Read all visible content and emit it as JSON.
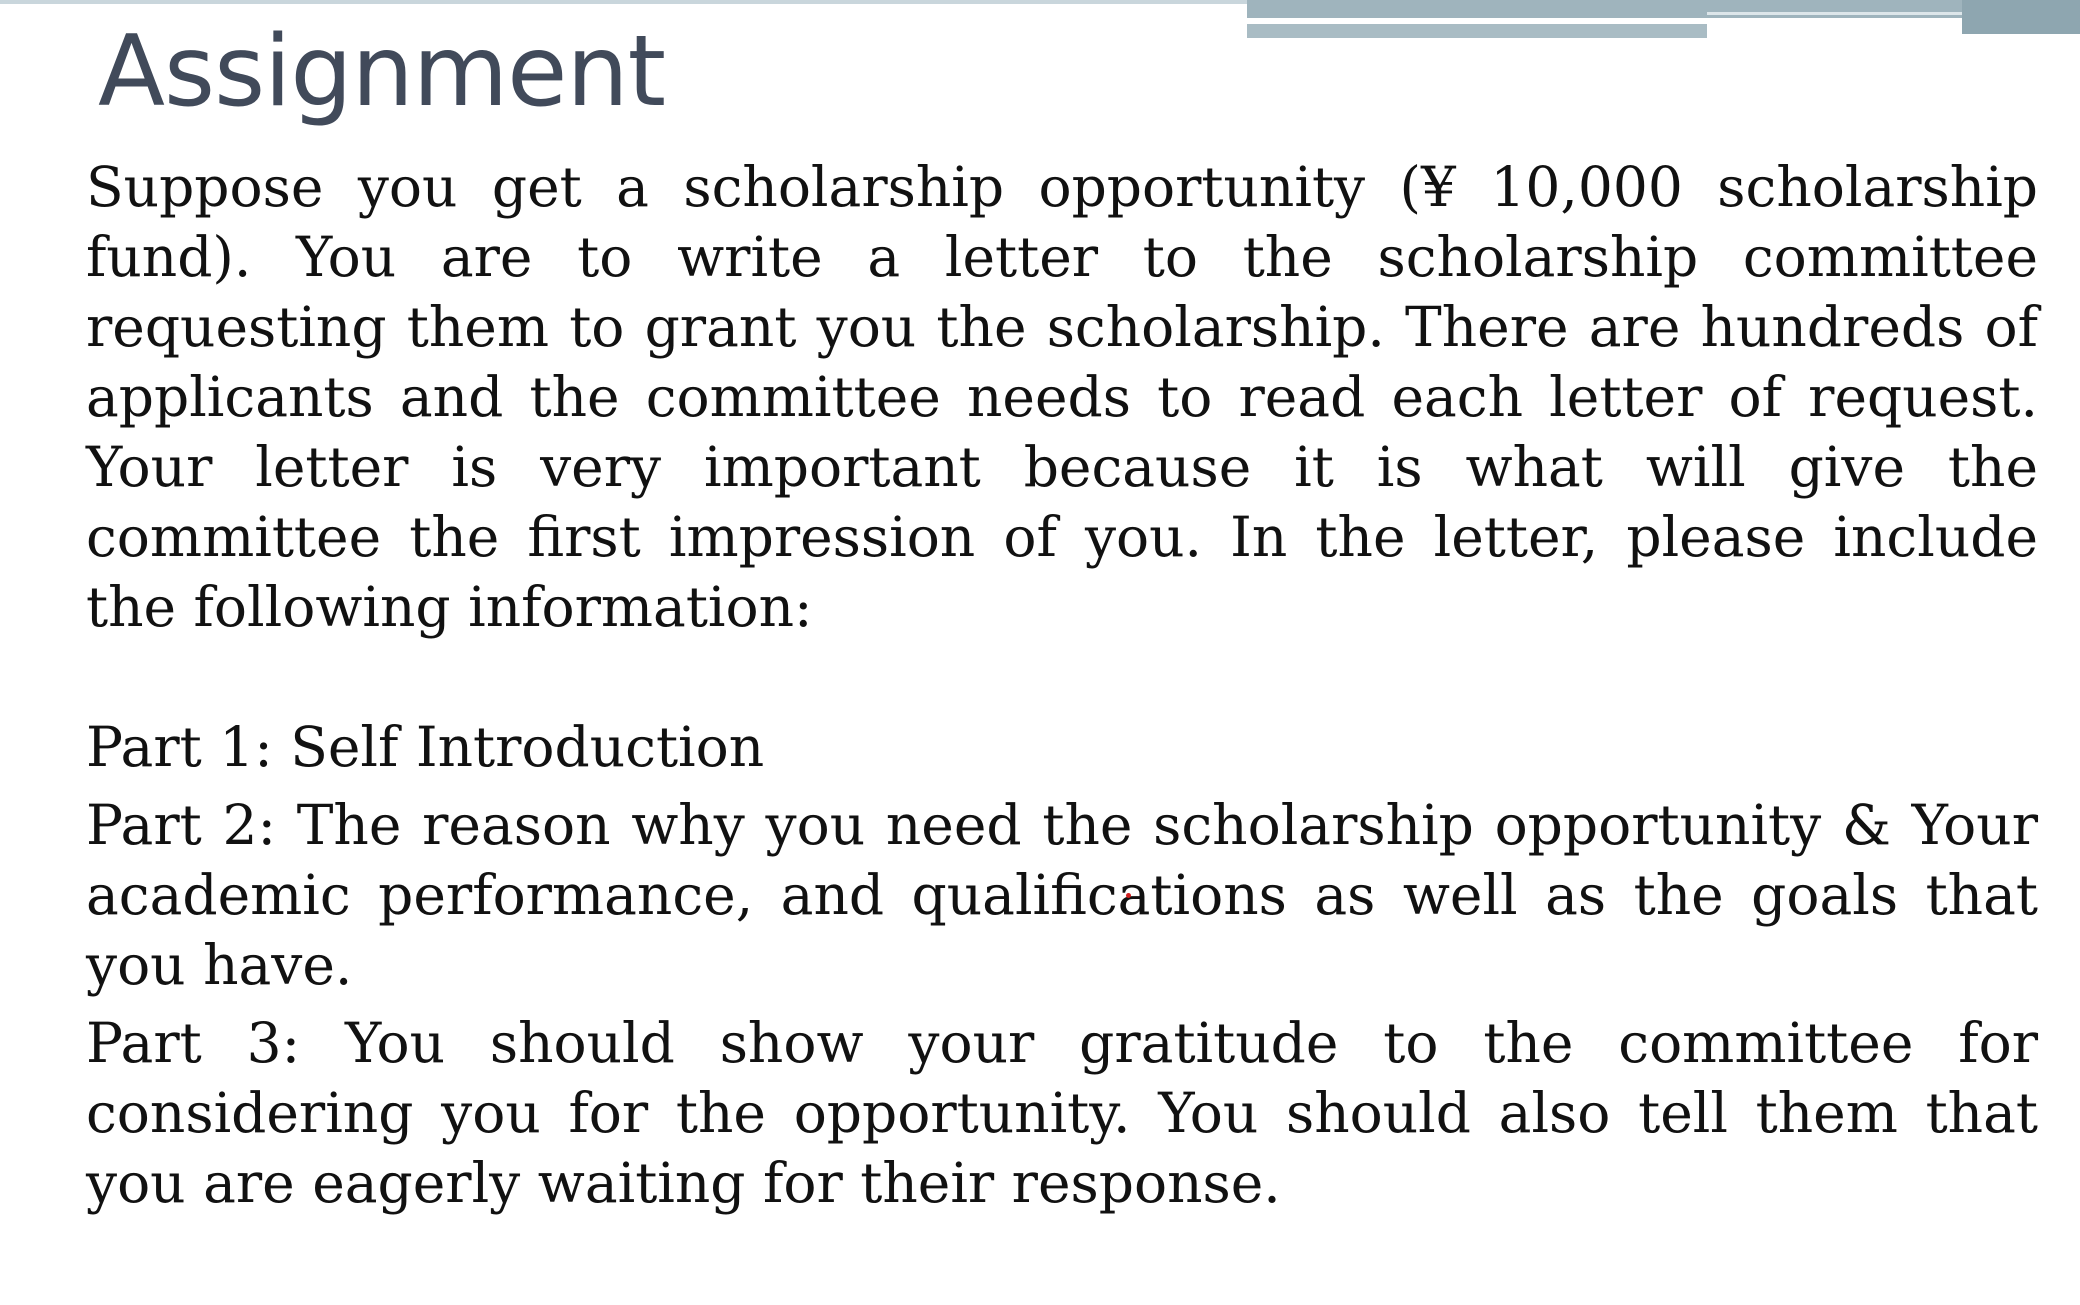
{
  "slide": {
    "title": "Assignment",
    "intro": "Suppose you get a scholarship opportunity (¥ 10,000 scholarship fund). You are to write a letter to the scholarship committee requesting them to grant you the scholarship. There are hundreds of applicants and the committee needs to read each letter of request. Your letter is very important because it is what will give the committee the first impression of you.  In the letter, please include the following information:",
    "parts": [
      "Part 1: Self Introduction",
      "Part 2: The reason why you need the scholarship opportunity & Your academic performance, and qualifications as well as the goals that you have.",
      "Part 3: You should show your gratitude to the committee for considering you for the opportunity. You should also tell them that you are eagerly waiting for their response."
    ]
  },
  "colors": {
    "title": "#414a5a",
    "text": "#111111",
    "accent_band": "#9fb4bd"
  }
}
